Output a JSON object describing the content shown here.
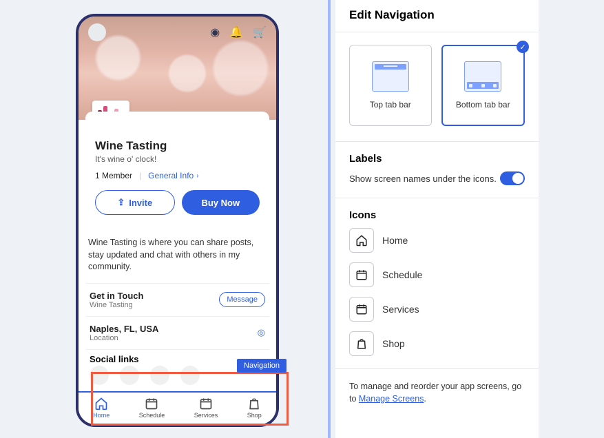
{
  "preview": {
    "title": "Wine Tasting",
    "subtitle": "It's wine o' clock!",
    "members": "1 Member",
    "general_info": "General Info",
    "invite_label": "Invite",
    "buy_label": "Buy Now",
    "description": "Wine Tasting is where you can share posts, stay updated and chat with others in my community.",
    "contact_heading": "Get in Touch",
    "contact_sub": "Wine Tasting",
    "message_btn": "Message",
    "location_heading": "Naples, FL, USA",
    "location_sub": "Location",
    "social_heading": "Social links",
    "nav_badge": "Navigation",
    "tabs": [
      {
        "label": "Home"
      },
      {
        "label": "Schedule"
      },
      {
        "label": "Services"
      },
      {
        "label": "Shop"
      }
    ]
  },
  "panel": {
    "heading": "Edit Navigation",
    "option_top": "Top tab bar",
    "option_bottom": "Bottom tab bar",
    "labels_heading": "Labels",
    "labels_text": "Show screen names under the icons.",
    "icons_heading": "Icons",
    "icons": [
      {
        "name": "Home"
      },
      {
        "name": "Schedule"
      },
      {
        "name": "Services"
      },
      {
        "name": "Shop"
      }
    ],
    "footer_prefix": "To manage and reorder your app screens, go to ",
    "footer_link": "Manage Screens",
    "footer_suffix": "."
  }
}
